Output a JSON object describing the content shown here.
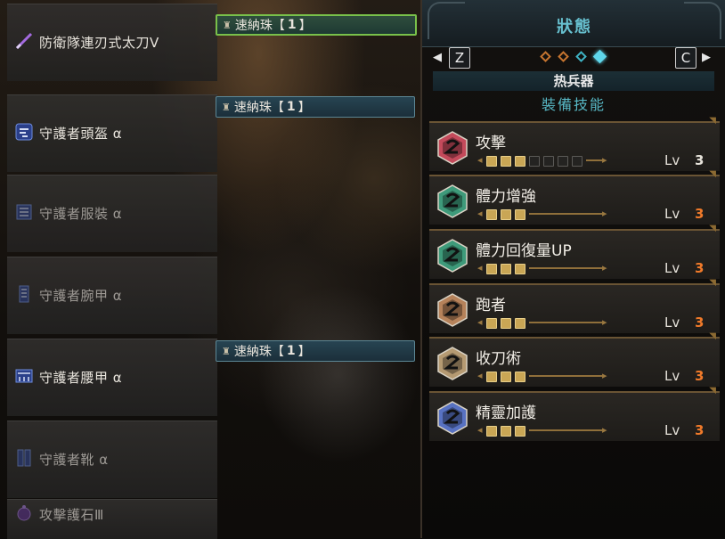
{
  "equipment": [
    {
      "name": "防衛隊連刃式太刀Ⅴ",
      "dim": false,
      "icon": "long-sword-icon",
      "color": "#8f55c9"
    },
    {
      "name": "守護者頭盔 α",
      "dim": false,
      "icon": "helmet-icon",
      "color": "#5c77d1"
    },
    {
      "name": "守護者服裝 α",
      "dim": true,
      "icon": "chest-armor-icon",
      "color": "#5c77d1"
    },
    {
      "name": "守護者腕甲 α",
      "dim": true,
      "icon": "arm-armor-icon",
      "color": "#5c77d1"
    },
    {
      "name": "守護者腰甲 α",
      "dim": false,
      "icon": "waist-armor-icon",
      "color": "#5c77d1"
    },
    {
      "name": "守護者靴 α",
      "dim": true,
      "icon": "leg-armor-icon",
      "color": "#5c77d1"
    },
    {
      "name": "攻擊護石Ⅲ",
      "dim": true,
      "icon": "charm-icon",
      "color": "#8f55c9"
    }
  ],
  "decorations": [
    {
      "name": "速納珠",
      "lv_open": "【",
      "lv": "1",
      "lv_close": "】",
      "selected": true
    },
    {
      "name": "速納珠",
      "lv_open": "【",
      "lv": "1",
      "lv_close": "】",
      "selected": false
    },
    {
      "name": "速納珠",
      "lv_open": "【",
      "lv": "1",
      "lv_close": "】",
      "selected": false
    }
  ],
  "panel": {
    "title": "狀態",
    "left_key": "Z",
    "right_key": "C",
    "page_dots": [
      {
        "color": "#c5742f",
        "active": false
      },
      {
        "color": "#c5742f",
        "active": false
      },
      {
        "color": "#3fb3c4",
        "active": false
      },
      {
        "color": "#5fd6ea",
        "active": true
      }
    ],
    "subheader": "热兵器",
    "section_title": "裝備技能",
    "lv_label": "Lv"
  },
  "skills": [
    {
      "name": "攻擊",
      "level": 3,
      "max": 7,
      "level_text": "3",
      "color": "#c44a5b",
      "lv_color": "#e6e2da"
    },
    {
      "name": "體力增強",
      "level": 3,
      "max": 3,
      "level_text": "3",
      "color": "#3e9a7a",
      "lv_color": "#f07a2a"
    },
    {
      "name": "體力回復量UP",
      "level": 3,
      "max": 3,
      "level_text": "3",
      "color": "#3e9a7a",
      "lv_color": "#f07a2a"
    },
    {
      "name": "跑者",
      "level": 3,
      "max": 3,
      "level_text": "3",
      "color": "#b6825a",
      "lv_color": "#f07a2a"
    },
    {
      "name": "收刀術",
      "level": 3,
      "max": 3,
      "level_text": "3",
      "color": "#b59a72",
      "lv_color": "#f07a2a"
    },
    {
      "name": "精靈加護",
      "level": 3,
      "max": 3,
      "level_text": "3",
      "color": "#5872c2",
      "lv_color": "#f07a2a"
    }
  ]
}
